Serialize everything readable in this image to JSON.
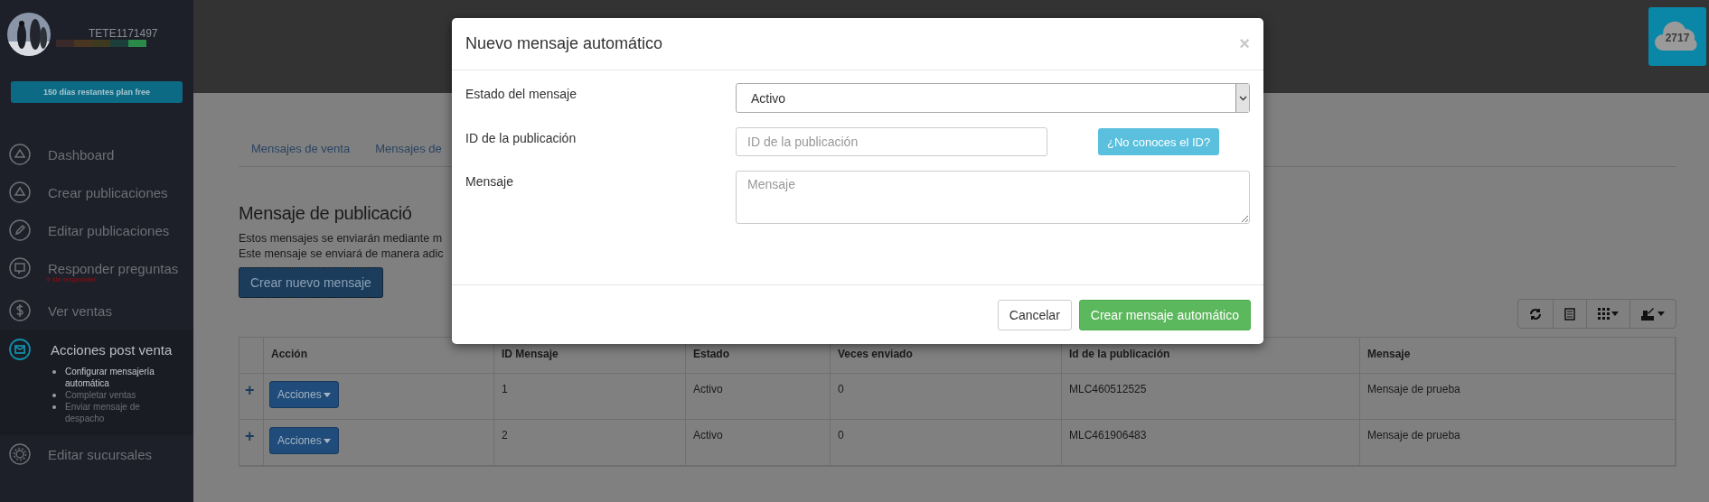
{
  "sidebar": {
    "user": {
      "name": "TETE1171497"
    },
    "plan_button": "150 días restantes plan free",
    "nav": [
      {
        "label": "Dashboard",
        "selected": false
      },
      {
        "label": "Crear publicaciones",
        "selected": false
      },
      {
        "label": "Editar publicaciones",
        "selected": false
      },
      {
        "label": "Responder preguntas",
        "note": "9 sin responder",
        "selected": false
      },
      {
        "label": "Ver ventas",
        "selected": false
      },
      {
        "label": "Acciones post venta",
        "selected": true,
        "children": [
          {
            "label": "Configurar mensajería automática",
            "selected": true
          },
          {
            "label": "Completar ventas",
            "selected": false
          },
          {
            "label": "Enviar mensaje de despacho",
            "selected": false
          }
        ]
      },
      {
        "label": "Editar sucursales",
        "selected": false
      }
    ]
  },
  "header": {
    "badge": "2717"
  },
  "tabs": [
    {
      "label": "Mensajes de venta",
      "selected": false
    },
    {
      "label": "Mensajes de",
      "selected": false
    }
  ],
  "page": {
    "title": "Mensaje de publicació",
    "lines": [
      "Estos mensajes se enviarán mediante m",
      "Este mensaje se enviará de manera adic"
    ],
    "create_button": "Crear nuevo mensaje"
  },
  "table": {
    "columns": [
      "",
      "Acción",
      "ID Mensaje",
      "Estado",
      "Veces enviado",
      "Id de la publicación",
      "Mensaje"
    ],
    "rows": [
      {
        "cells": [
          "+",
          "Acciones",
          "1",
          "Activo",
          "0",
          "MLC460512525",
          "Mensaje de prueba"
        ]
      },
      {
        "cells": [
          "+",
          "Acciones",
          "2",
          "Activo",
          "0",
          "MLC461906483",
          "Mensaje de prueba"
        ]
      }
    ]
  },
  "modal": {
    "title": "Nuevo mensaje automático",
    "close": "×",
    "fields": [
      {
        "kind": "select",
        "label": "Estado del mensaje",
        "value": "Activo"
      },
      {
        "kind": "input",
        "label": "ID de la publicación",
        "placeholder": "ID de la publicación",
        "help_button": "¿No conoces el ID?"
      },
      {
        "kind": "textarea",
        "label": "Mensaje",
        "placeholder": "Mensaje"
      }
    ],
    "buttons": [
      {
        "label": "Cancelar",
        "kind": "default"
      },
      {
        "label": "Crear mensaje automático",
        "kind": "primary"
      }
    ]
  }
}
